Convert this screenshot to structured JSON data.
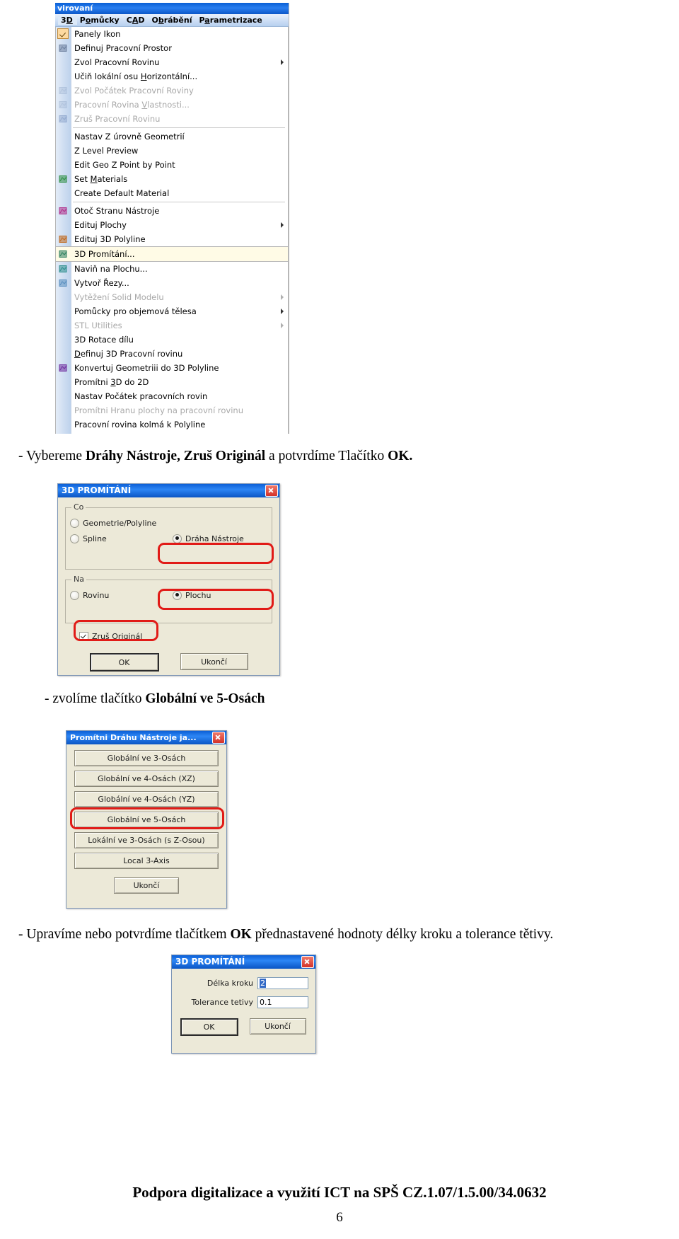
{
  "menu_screenshot": {
    "window_caption": "virovaní",
    "menubar": [
      {
        "label": "3D",
        "active": true
      },
      {
        "label": "Pomůcky",
        "active": false
      },
      {
        "label": "CAD",
        "active": false
      },
      {
        "label": "Obrábění",
        "active": false
      },
      {
        "label": "Parametrizace",
        "active": false
      }
    ],
    "items": [
      {
        "label": "Panely Ikon",
        "state": "checked",
        "icon": "checkbox-checked-icon",
        "submenu": false,
        "sep_after": false
      },
      {
        "label": "Definuj Pracovní Prostor",
        "state": "normal",
        "icon": "cube-icon",
        "submenu": false,
        "sep_after": false
      },
      {
        "label": "Zvol Pracovní Rovinu",
        "state": "normal",
        "icon": "",
        "submenu": true,
        "sep_after": false
      },
      {
        "label": "Učiň lokální osu Horizontální...",
        "state": "normal",
        "icon": "",
        "submenu": false,
        "sep_after": false
      },
      {
        "label": "Zvol Počátek Pracovní Roviny",
        "state": "disabled",
        "icon": "origin-icon",
        "submenu": false,
        "sep_after": false
      },
      {
        "label": "Pracovní Rovina Vlastnosti...",
        "state": "disabled",
        "icon": "plane-props-icon",
        "submenu": false,
        "sep_after": false
      },
      {
        "label": "Zruš Pracovní Rovinu",
        "state": "disabled",
        "icon": "flag-icon",
        "submenu": false,
        "sep_after": true
      },
      {
        "label": "Nastav Z úrovně Geometrií",
        "state": "normal",
        "icon": "",
        "submenu": false,
        "sep_after": false
      },
      {
        "label": "Z Level Preview",
        "state": "normal",
        "icon": "",
        "submenu": false,
        "sep_after": false
      },
      {
        "label": "Edit Geo Z Point by Point",
        "state": "normal",
        "icon": "",
        "submenu": false,
        "sep_after": false
      },
      {
        "label": "Set Materials",
        "state": "normal",
        "icon": "material-icon",
        "submenu": false,
        "sep_after": false
      },
      {
        "label": "Create Default Material",
        "state": "normal",
        "icon": "",
        "submenu": false,
        "sep_after": true
      },
      {
        "label": "Otoč Stranu Nástroje",
        "state": "normal",
        "icon": "flip-tool-icon",
        "submenu": false,
        "sep_after": false
      },
      {
        "label": "Edituj Plochy",
        "state": "normal",
        "icon": "",
        "submenu": true,
        "sep_after": false
      },
      {
        "label": "Edituj 3D Polyline",
        "state": "normal",
        "icon": "polyline-edit-icon",
        "submenu": false,
        "sep_after": false
      },
      {
        "label": "3D Promítání...",
        "state": "highlight",
        "icon": "projection-icon",
        "submenu": false,
        "sep_after": false
      },
      {
        "label": "Naviň na Plochu...",
        "state": "normal",
        "icon": "wrap-icon",
        "submenu": false,
        "sep_after": false
      },
      {
        "label": "Vytvoř Řezy...",
        "state": "normal",
        "icon": "sections-icon",
        "submenu": false,
        "sep_after": false
      },
      {
        "label": "Vytěžení Solid Modelu",
        "state": "disabled",
        "icon": "",
        "submenu": true,
        "sep_after": false
      },
      {
        "label": "Pomůcky pro objemová tělesa",
        "state": "normal",
        "icon": "",
        "submenu": true,
        "sep_after": false
      },
      {
        "label": "STL Utilities",
        "state": "disabled",
        "icon": "",
        "submenu": true,
        "sep_after": false
      },
      {
        "label": "3D Rotace dílu",
        "state": "normal",
        "icon": "",
        "submenu": false,
        "sep_after": false
      },
      {
        "label": "Definuj 3D Pracovní rovinu",
        "state": "normal",
        "icon": "",
        "submenu": false,
        "sep_after": false
      },
      {
        "label": "Konvertuj Geometriii do 3D Polyline",
        "state": "normal",
        "icon": "convert-polyline-icon",
        "submenu": false,
        "sep_after": false
      },
      {
        "label": "Promítni 3D do 2D",
        "state": "normal",
        "icon": "",
        "submenu": false,
        "sep_after": false
      },
      {
        "label": "Nastav Počátek pracovních rovin",
        "state": "normal",
        "icon": "",
        "submenu": false,
        "sep_after": false
      },
      {
        "label": "Promítni Hranu plochy na pracovní rovinu",
        "state": "disabled",
        "icon": "",
        "submenu": false,
        "sep_after": false
      },
      {
        "label": "Pracovní rovina kolmá k Polyline",
        "state": "normal",
        "icon": "",
        "submenu": false,
        "sep_after": false
      }
    ]
  },
  "steps": {
    "step1_prefix": "-   Vybereme ",
    "step1_bold1": "Dráhy Nástroje, Zruš Originál",
    "step1_mid": " a potvrdíme Tlačítko ",
    "step1_bold2": "OK.",
    "step2_prefix": "- zvolíme tlačítko ",
    "step2_bold": "Globální ve 5-Osách",
    "step3_prefix": "- Upravíme nebo potvrdíme tlačítkem ",
    "step3_bold": "OK",
    "step3_suffix": " přednastavené hodnoty délky kroku a tolerance tětivy."
  },
  "dialog_projection": {
    "title": "3D PROMÍTÁNÍ",
    "close_label": "×",
    "group_co": {
      "label": "Co",
      "options": [
        {
          "label": "Geometrie/Polyline",
          "checked": false,
          "highlighted": false
        },
        {
          "label": "Spline",
          "checked": false,
          "highlighted": false
        },
        {
          "label": "Dráha Nástroje",
          "checked": true,
          "highlighted": true
        }
      ]
    },
    "group_na": {
      "label": "Na",
      "options": [
        {
          "label": "Rovinu",
          "checked": false,
          "highlighted": false
        },
        {
          "label": "Plochu",
          "checked": true,
          "highlighted": true
        }
      ]
    },
    "checkbox": {
      "label": "Zruš Originál",
      "checked": true,
      "highlighted": true
    },
    "buttons": [
      {
        "label": "OK",
        "default": true
      },
      {
        "label": "Ukončí",
        "default": false
      }
    ]
  },
  "dialog_axes": {
    "title": "Promítni Dráhu Nástroje ja...",
    "close_label": "×",
    "buttons": [
      {
        "label": "Globální ve 3-Osách",
        "highlighted": false
      },
      {
        "label": "Globální ve 4-Osách (XZ)",
        "highlighted": false
      },
      {
        "label": "Globální ve 4-Osách (YZ)",
        "highlighted": false
      },
      {
        "label": "Globální ve 5-Osách",
        "highlighted": true
      },
      {
        "label": "Lokální ve  3-Osách (s Z-Osou)",
        "highlighted": false
      },
      {
        "label": "Local 3-Axis",
        "highlighted": false
      }
    ],
    "close_button": {
      "label": "Ukončí"
    }
  },
  "dialog_params": {
    "title": "3D PROMÍTÁNÍ",
    "close_label": "×",
    "fields": [
      {
        "label": "Délka kroku",
        "value": "2",
        "selected": true
      },
      {
        "label": "Tolerance tetivy",
        "value": "0.1",
        "selected": false
      }
    ],
    "buttons": [
      {
        "label": "OK",
        "default": true
      },
      {
        "label": "Ukončí",
        "default": false
      }
    ]
  },
  "footer": {
    "text": "Podpora digitalizace a využití ICT na SPŠ  CZ.1.07/1.5.00/34.0632",
    "page_number": "6"
  }
}
